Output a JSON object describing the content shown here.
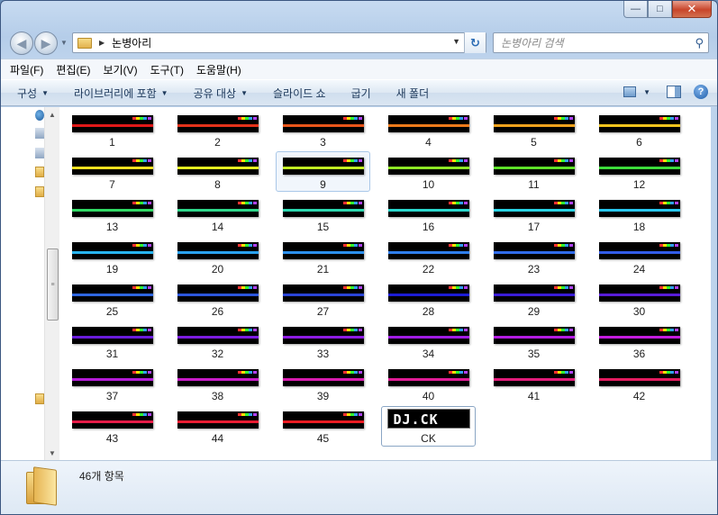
{
  "window": {
    "minimize": "—",
    "maximize": "□",
    "close": "✕"
  },
  "nav": {
    "back_icon": "back-arrow-icon",
    "forward_icon": "forward-arrow-icon",
    "address_path": "논병아리",
    "search_placeholder": "논병아리 검색"
  },
  "menubar": [
    "파일(F)",
    "편집(E)",
    "보기(V)",
    "도구(T)",
    "도움말(H)"
  ],
  "toolbar": {
    "organize": "구성",
    "library": "라이브러리에 포함",
    "share": "공유 대상",
    "slideshow": "슬라이드 쇼",
    "burn": "굽기",
    "new_folder": "새 폴더"
  },
  "files": [
    {
      "name": "1",
      "color": "#e01818"
    },
    {
      "name": "2",
      "color": "#e3321a"
    },
    {
      "name": "3",
      "color": "#e8551a"
    },
    {
      "name": "4",
      "color": "#ec7a1b"
    },
    {
      "name": "5",
      "color": "#f0a21d"
    },
    {
      "name": "6",
      "color": "#f3c41e"
    },
    {
      "name": "7",
      "color": "#f5e01f"
    },
    {
      "name": "8",
      "color": "#e5ee20"
    },
    {
      "name": "9",
      "color": "#c0ec22"
    },
    {
      "name": "10",
      "color": "#8ee824"
    },
    {
      "name": "11",
      "color": "#5ee228"
    },
    {
      "name": "12",
      "color": "#3cdc3a"
    },
    {
      "name": "13",
      "color": "#30d864"
    },
    {
      "name": "14",
      "color": "#2ed68a"
    },
    {
      "name": "15",
      "color": "#2cd6ae"
    },
    {
      "name": "16",
      "color": "#2ad6cc"
    },
    {
      "name": "17",
      "color": "#28d2e2"
    },
    {
      "name": "18",
      "color": "#28c6ee"
    },
    {
      "name": "19",
      "color": "#28b4f0"
    },
    {
      "name": "20",
      "color": "#2aa2f0"
    },
    {
      "name": "21",
      "color": "#2c90ee"
    },
    {
      "name": "22",
      "color": "#2e7eec"
    },
    {
      "name": "23",
      "color": "#306cea"
    },
    {
      "name": "24",
      "color": "#325ce8"
    },
    {
      "name": "25",
      "color": "#2e66e0"
    },
    {
      "name": "26",
      "color": "#2c56dc"
    },
    {
      "name": "27",
      "color": "#2a44d6"
    },
    {
      "name": "28",
      "color": "#1c1cd4"
    },
    {
      "name": "29",
      "color": "#3a1cd6"
    },
    {
      "name": "30",
      "color": "#581cd8"
    },
    {
      "name": "31",
      "color": "#6a1cdc"
    },
    {
      "name": "32",
      "color": "#7c1ce0"
    },
    {
      "name": "33",
      "color": "#8e1ce4"
    },
    {
      "name": "34",
      "color": "#a01ce4"
    },
    {
      "name": "35",
      "color": "#b41ce2"
    },
    {
      "name": "36",
      "color": "#c41cde"
    },
    {
      "name": "37",
      "color": "#b41cd8"
    },
    {
      "name": "38",
      "color": "#c81cc8"
    },
    {
      "name": "39",
      "color": "#d81cb0"
    },
    {
      "name": "40",
      "color": "#e01c96"
    },
    {
      "name": "41",
      "color": "#e21c7a"
    },
    {
      "name": "42",
      "color": "#e41c60"
    },
    {
      "name": "43",
      "color": "#e61c48"
    },
    {
      "name": "44",
      "color": "#e81c32"
    },
    {
      "name": "45",
      "color": "#ea1c22"
    }
  ],
  "special_file": {
    "name": "CK",
    "thumb_text": "DJ.CK"
  },
  "status": {
    "count": "46개 항목"
  }
}
